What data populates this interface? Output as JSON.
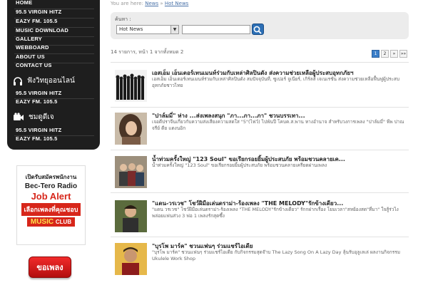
{
  "nav": {
    "items_top": [
      "HOME",
      "95.5 VIRGIN HITZ",
      "EAZY FM. 105.5",
      "MUSIC DOWNLOAD",
      "GALLERY",
      "WEBBOARD",
      "ABOUT US",
      "CONTACT US"
    ],
    "listen_online_label": "ฟังวิทยุออนไลน์",
    "listen_items": [
      "95.5 VIRGIN HITZ",
      "EAZY FM. 105.5"
    ],
    "watch_label": "ชมดูดีเจ",
    "watch_items": [
      "95.5 VIRGIN HITZ",
      "EAZY FM. 105.5"
    ]
  },
  "ad": {
    "line1": "เปิดรับสมัครพนักงาน",
    "line2": "Bec-Tero Radio",
    "line3": "Job Alert",
    "line4": "เลือกเพลงที่คุณชอบ",
    "line5": "MUSIC",
    "line5b": "CLUB"
  },
  "request_button": "ขอเพลง",
  "breadcrumb": {
    "prefix": "You are here:",
    "home": "News",
    "sep": "»",
    "current": "Hot News"
  },
  "search": {
    "label": "ค้นหา :",
    "category_value": "Hot News",
    "query_value": ""
  },
  "results": {
    "count_text": "14 รายการ, หน้า 1 จากทั้งหมด 2",
    "pages": [
      "1",
      "2",
      "»",
      "»»"
    ]
  },
  "news": [
    {
      "title": "เอสเอ็ม เอ็นเตอร์เทนเมนท์ร่วมกับเหล่าศิลปินดัง ส่งความช่วยเหลือผู้ประสบอุทกภัยฯ",
      "desc": "เอสเอ็ม เอ็นเตอร์เทนเมนท์ร่วมกับเหล่าศิลปินดัง สมปัจจุบันที่, ซูเปอร์ จูเนียร์, เกิร์ลส์ เจเนเรชั่น ส่งความช่วยเหลือฟื้นฟูผู้ประสบอุทกภัยชาวไทย"
    },
    {
      "title": "\"ปาล์มมี่\" ห่าง ...ส่งเพลงสนุก \"ภา...ภา...ภา\" ชวนบรรเทา...",
      "desc": "เจอดีปราจีนเกี่ยวกับความส่งเสียงความสดใส \"5\"(ไฟว์) ไปพันปี โคบค.ส.พาน หางอำนาจ สำหรับวงการเพลง \"ปาล์มมี่\" พีพ ปาณจรีย์ ดีย แดงนอิก"
    },
    {
      "title": "น้ำท่วมครั้งใหญ่ \"123 Soul\" ขอเรียกรอยยิ้มผู้ประสบภัย พร้อมชวนคลายเค...",
      "desc": "น้ำท่วมครั้งใหญ่ \"123 Soul\" ขอเรียกรอยยิ้มผู้ประสบภัย พร้อมชวนคลายเครียดผ่านเพลง"
    },
    {
      "title": "\"แดน-วรเวช\" โชว์ฝีมือเล่นดราม่า-ร้องเพลง \"THE MELODY\"รักข้างเดียว...",
      "desc": "\"แดน วรเวช\" โชว์ฝีมือเล่นดราม่า-ร้องเพลง \"THE MELODY\"รักข้างเดียว\" รักกฝากเรื่อง โยมเวลา\"สหย้องสด\"ที่มา\" ใจสู้ร่วไง พล่อยแฟนส่วง 3 ฟอ 1 เพลงรักสุดซึ้ง"
    },
    {
      "title": "\"บุรโพ มาร์ค\" ชวนแฟนๆ ร่วมแชร์ไอเดีย",
      "desc": "\"บุรโพ มาร์ค\" ชวนแฟนๆ ร่วมแชร์ไอเดีย กับกิจกรรมสุดจ๊าบ The Lazy Song On A Lazy Day ลุ้นรับอุลูเลเล่ ผลงานกิจกรรม Ukulele Work Shop"
    }
  ],
  "colors": {
    "nav_bg": "#1e1e1e",
    "accent": "#2c6fb5",
    "ad_red": "#d7261a"
  }
}
